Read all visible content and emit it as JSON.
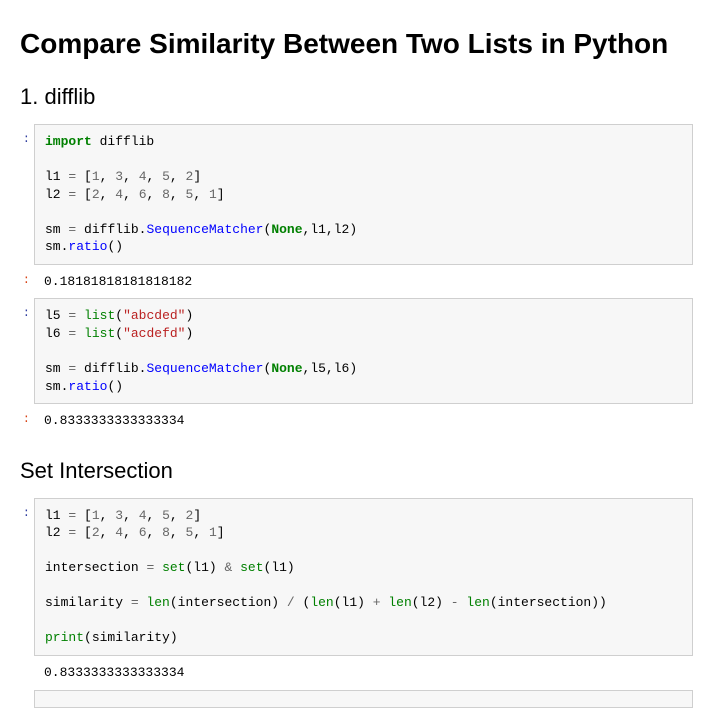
{
  "title": "Compare Similarity Between Two Lists in Python",
  "section1_title": "1. difflib",
  "section2_title": "Set Intersection",
  "output1": "0.18181818181818182",
  "output2": "0.8333333333333334",
  "output3": "0.8333333333333334",
  "tok": {
    "import": "import",
    "difflib": "difflib",
    "l1": "l1",
    "l2": "l2",
    "l5": "l5",
    "l6": "l6",
    "sm": "sm",
    "eq": "=",
    "n1": "1",
    "n2": "2",
    "n3": "3",
    "n4": "4",
    "n5": "5",
    "n6": "6",
    "n8": "8",
    "SequenceMatcher": "SequenceMatcher",
    "None": "None",
    "ratio": "ratio",
    "list": "list",
    "s_abcded": "\"abcded\"",
    "s_acdefd": "\"acdefd\"",
    "intersection": "intersection",
    "set": "set",
    "amp": "&",
    "similarity": "similarity",
    "len": "len",
    "slash": "/",
    "plus": "+",
    "minus": "-",
    "print": "print"
  }
}
